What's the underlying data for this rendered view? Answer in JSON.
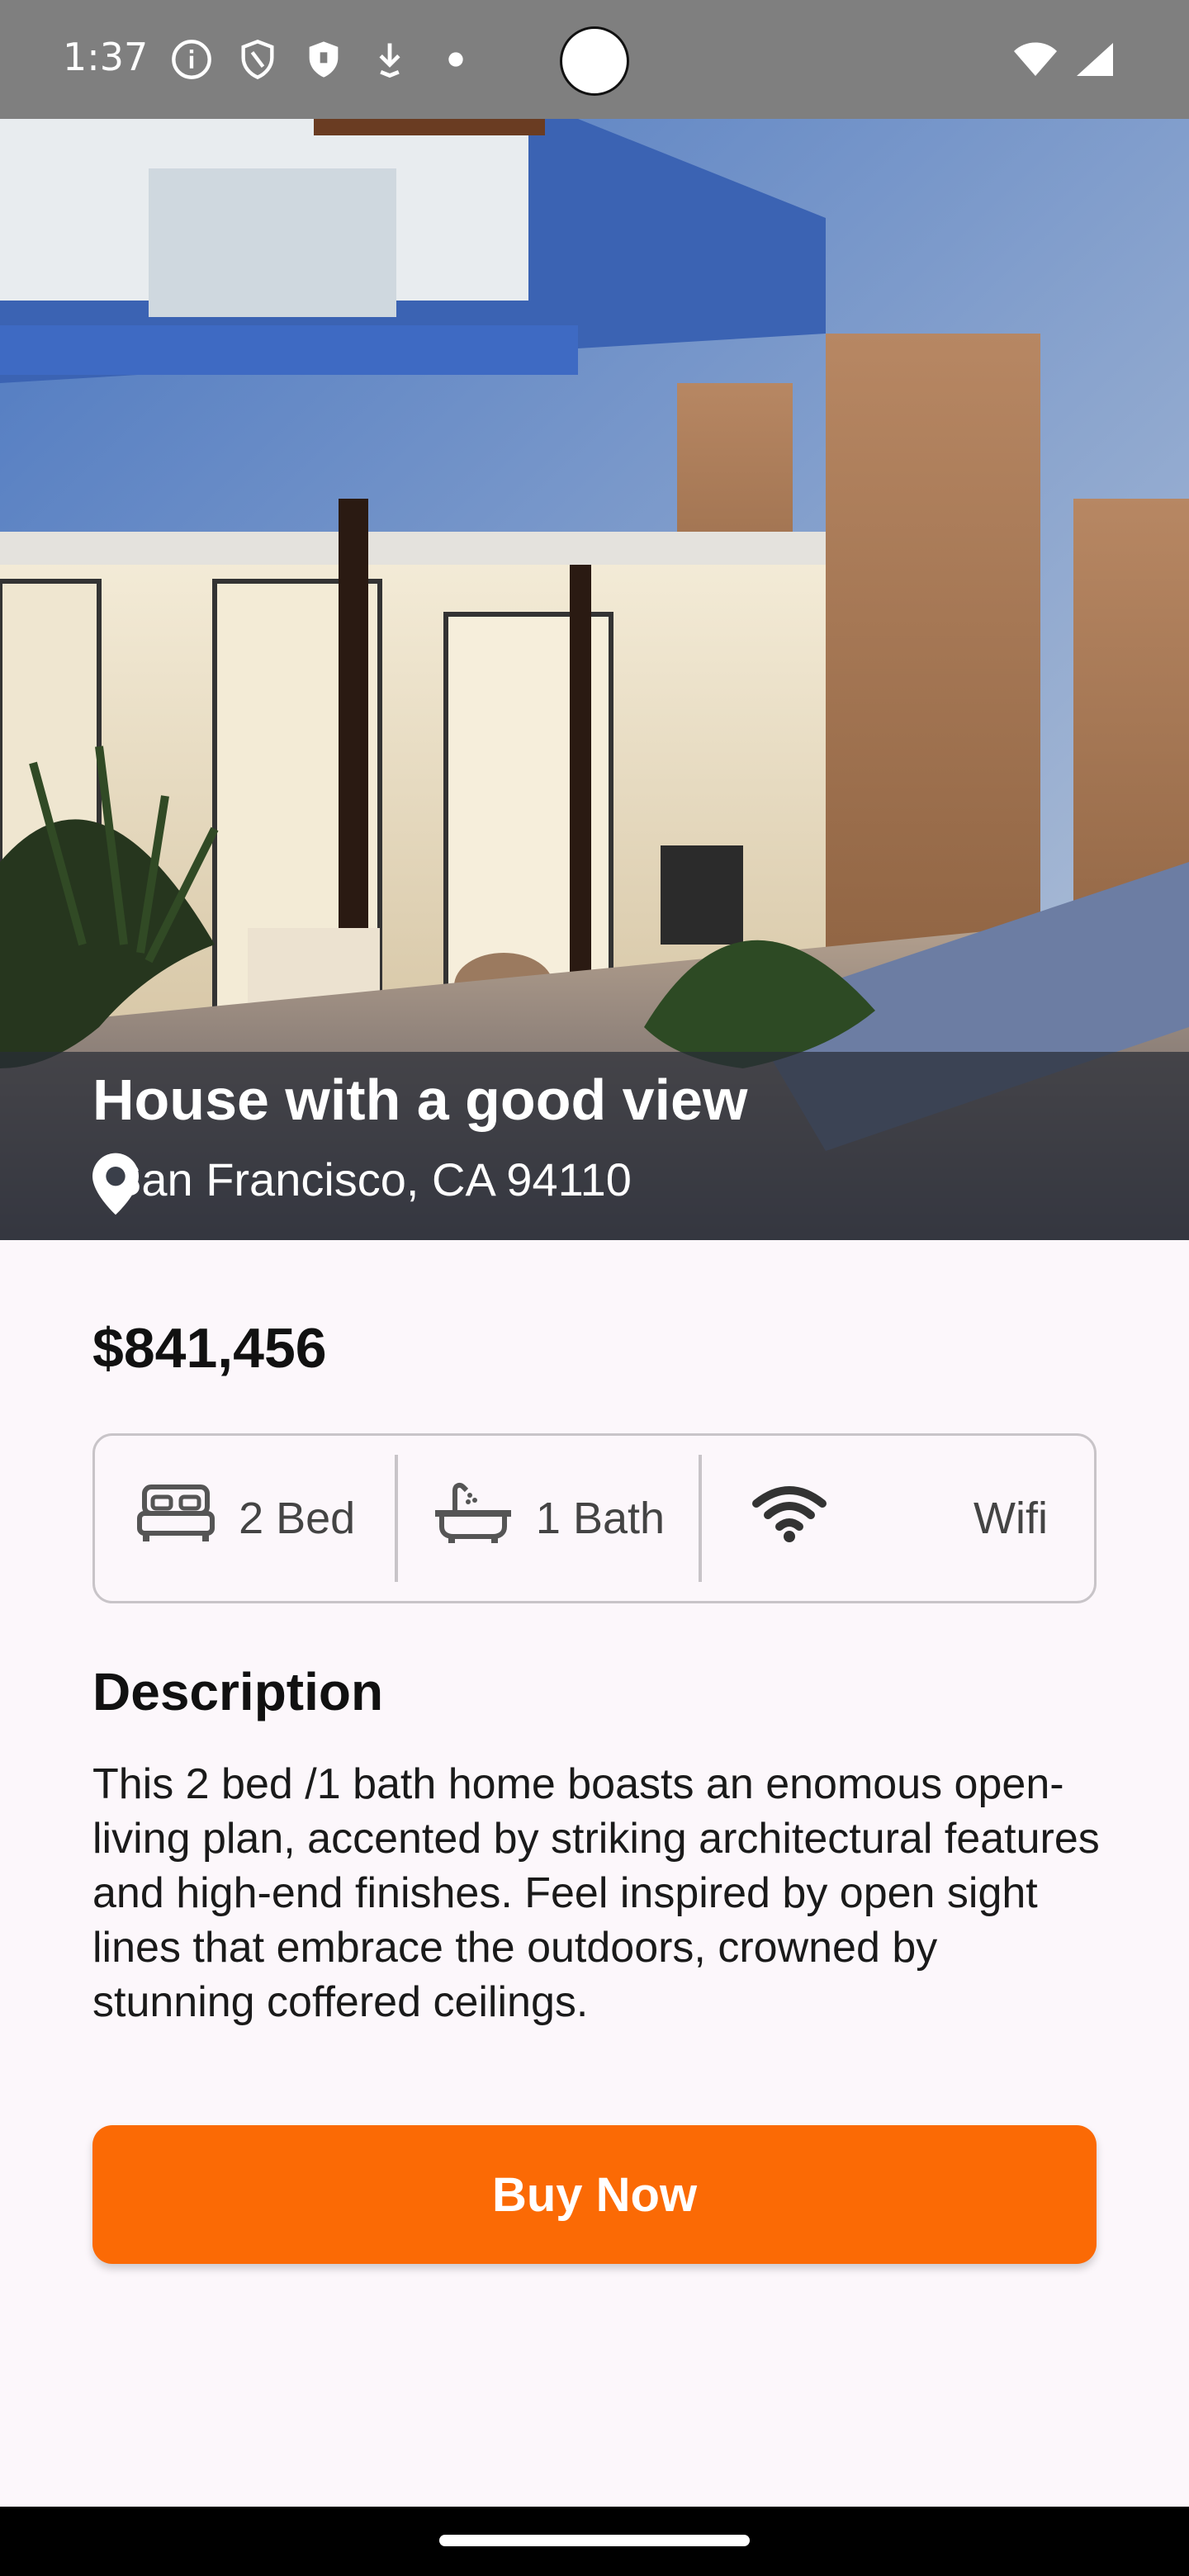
{
  "status_bar": {
    "time": "1:37",
    "left_icons": [
      "info-icon",
      "shield-icon",
      "security-badge-icon",
      "download-icon",
      "dot-icon"
    ],
    "right_icons": [
      "wifi-icon",
      "signal-icon"
    ]
  },
  "listing": {
    "title": "House with a good view",
    "location": "San Francisco, CA 94110",
    "price": "$841,456",
    "features": [
      {
        "icon": "bed-icon",
        "label": "2 Bed"
      },
      {
        "icon": "bathtub-icon",
        "label": "1 Bath"
      },
      {
        "icon": "wifi-icon",
        "label": "Wifi"
      }
    ],
    "description_title": "Description",
    "description": "This 2 bed /1 bath home boasts an enomous open-living plan, accented by striking architectural features and high-end finishes. Feel inspired by open sight lines that embrace the outdoors, crowned by stunning coffered ceilings."
  },
  "actions": {
    "buy_label": "Buy Now"
  },
  "colors": {
    "accent": "#fb6a05",
    "background": "#fcf7fb",
    "status_bar": "#7f7f7f"
  }
}
